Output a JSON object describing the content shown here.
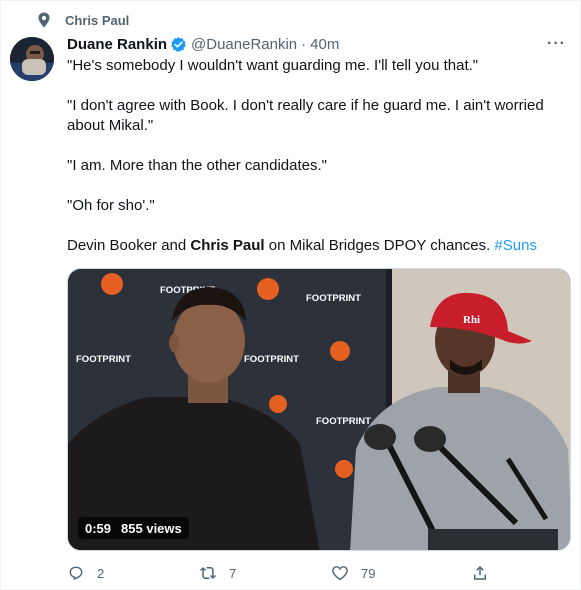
{
  "context": {
    "label": "Chris Paul",
    "icon": "pin-icon"
  },
  "author": {
    "name": "Duane Rankin",
    "handle": "@DuaneRankin",
    "separator": "·",
    "time": "40m",
    "verified": true,
    "verified_color": "#1d9bf0"
  },
  "tweet": {
    "line1": "\"He's somebody I wouldn't want guarding me. I'll tell you that.\"",
    "line2": "\"I don't agree with Book. I don't really care if he guard me. I ain't worried about Mikal.\"",
    "line3": "\"I am. More than the other candidates.\"",
    "line4": "\"Oh for sho'.\"",
    "line5_before": "Devin Booker and ",
    "line5_bold": "Chris Paul",
    "line5_after": " on Mikal Bridges DPOY chances. ",
    "hashtag": "#Suns"
  },
  "media": {
    "duration": "0:59",
    "views": "855 views",
    "backdrop_sponsor": "FOOTPRINT",
    "hat_text": "Rhi"
  },
  "actions": {
    "replies": "2",
    "retweets": "7",
    "likes": "79"
  },
  "colors": {
    "text": "#0f1419",
    "muted": "#536471",
    "accent": "#1d9bf0",
    "suns_orange": "#e56020"
  }
}
